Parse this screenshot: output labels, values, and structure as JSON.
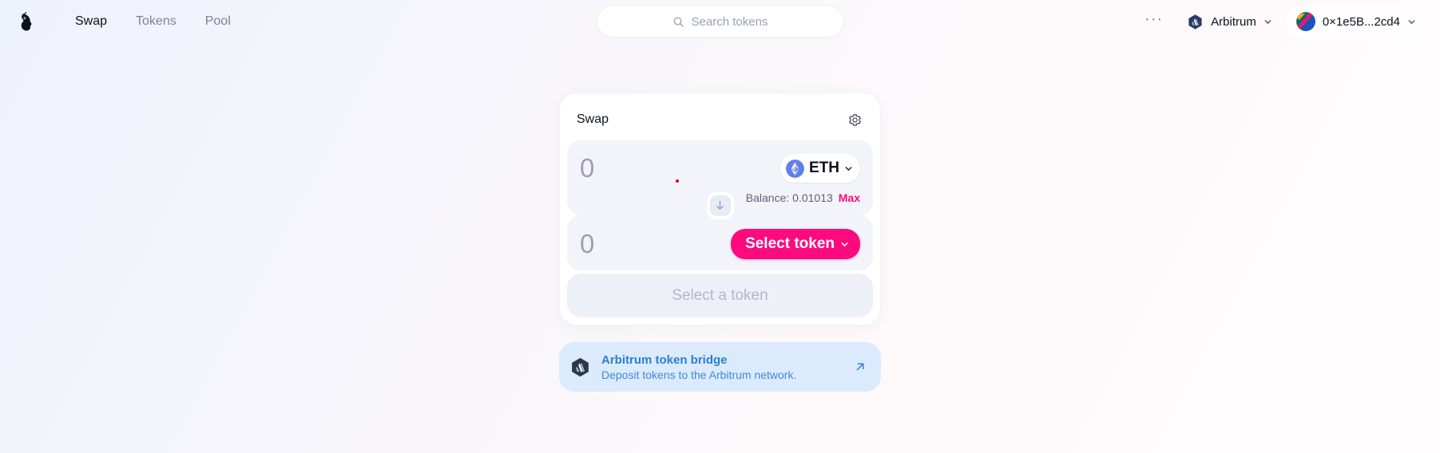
{
  "header": {
    "logo_icon": "uniswap-unicorn-logo",
    "nav": [
      {
        "label": "Swap",
        "active": true
      },
      {
        "label": "Tokens",
        "active": false
      },
      {
        "label": "Pool",
        "active": false
      }
    ],
    "search": {
      "placeholder": "Search tokens",
      "value": "",
      "icon": "search-icon"
    },
    "more_label": "···",
    "chain": {
      "label": "Arbitrum",
      "icon": "arbitrum-logo",
      "chevron": "chevron-down-icon"
    },
    "wallet": {
      "address": "0×1e5B...2cd4",
      "avatar": "wallet-avatar",
      "chevron": "chevron-down-icon"
    }
  },
  "swap": {
    "title": "Swap",
    "settings_icon": "gear-icon",
    "input": {
      "amount": "0",
      "fiat_value": "",
      "token_symbol": "ETH",
      "token_icon": "ethereum-logo",
      "chevron": "chevron-down-icon",
      "balance_label": "Balance: 0.01013",
      "max_label": "Max"
    },
    "switch_icon": "arrow-down-icon",
    "output": {
      "amount": "0",
      "select_token_label": "Select token",
      "chevron": "chevron-down-icon"
    },
    "cta_label": "Select a token"
  },
  "bridge": {
    "title": "Arbitrum token bridge",
    "subtitle": "Deposit tokens to the Arbitrum network.",
    "logo_icon": "arbitrum-logo",
    "external_icon": "external-link-arrow-icon"
  },
  "colors": {
    "accent_pink": "#fc0a7e",
    "bridge_blue": "#2a7fd4",
    "bridge_bg": "#dbeafd",
    "panel_bg": "#f3f4fa",
    "text_primary": "#0d111c",
    "text_muted": "#9ca0b2"
  }
}
